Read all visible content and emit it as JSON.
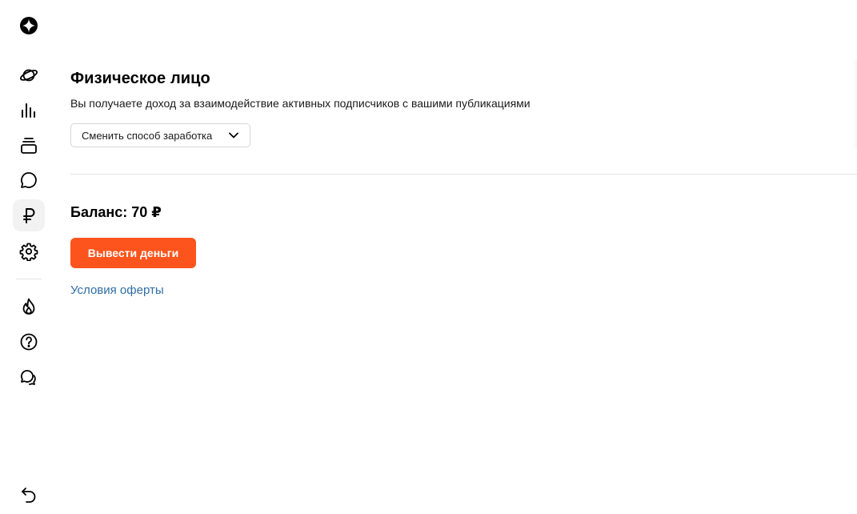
{
  "sidebar": {
    "items": [
      {
        "icon": "logo-icon"
      },
      {
        "icon": "planet-icon"
      },
      {
        "icon": "stats-icon"
      },
      {
        "icon": "stack-icon"
      },
      {
        "icon": "comment-icon"
      },
      {
        "icon": "ruble-icon",
        "active": true
      },
      {
        "icon": "gear-icon"
      },
      {
        "icon": "fire-icon"
      },
      {
        "icon": "help-icon"
      },
      {
        "icon": "chat-icon"
      },
      {
        "icon": "back-icon"
      }
    ]
  },
  "main": {
    "title": "Физическое лицо",
    "description": "Вы получаете доход за взаимодействие активных подписчиков с вашими публикациями",
    "mode_select_label": "Сменить способ заработка",
    "balance": "Баланс: 70 ₽",
    "withdraw_button": "Вывести деньги",
    "offer_link": "Условия оферты"
  },
  "colors": {
    "accent": "#fc541c",
    "link": "#2e6da4"
  }
}
